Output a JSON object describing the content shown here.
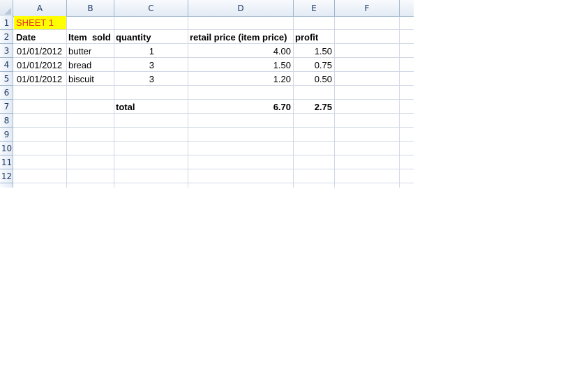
{
  "columns": [
    "A",
    "B",
    "C",
    "D",
    "E",
    "F"
  ],
  "rows": [
    "1",
    "2",
    "3",
    "4",
    "5",
    "6",
    "7",
    "8",
    "9",
    "10",
    "11",
    "12"
  ],
  "sheet_label": "SHEET 1",
  "headers": {
    "date": "Date",
    "item": "Item  sold",
    "quantity": "quantity",
    "retail": "retail price (item price)",
    "profit": "profit"
  },
  "records": [
    {
      "date": "01/01/2012",
      "item": "butter",
      "quantity": "1",
      "retail": "4.00",
      "profit": "1.50"
    },
    {
      "date": "01/01/2012",
      "item": "bread",
      "quantity": "3",
      "retail": "1.50",
      "profit": "0.75"
    },
    {
      "date": "01/01/2012",
      "item": "biscuit",
      "quantity": "3",
      "retail": "1.20",
      "profit": "0.50"
    }
  ],
  "totals": {
    "label": "total",
    "retail": "6.70",
    "profit": "2.75"
  },
  "colors": {
    "highlight_fill": "#ffff00",
    "highlight_text": "#e8331c",
    "grid": "#d0d7e5",
    "header_text": "#1f3a64"
  }
}
